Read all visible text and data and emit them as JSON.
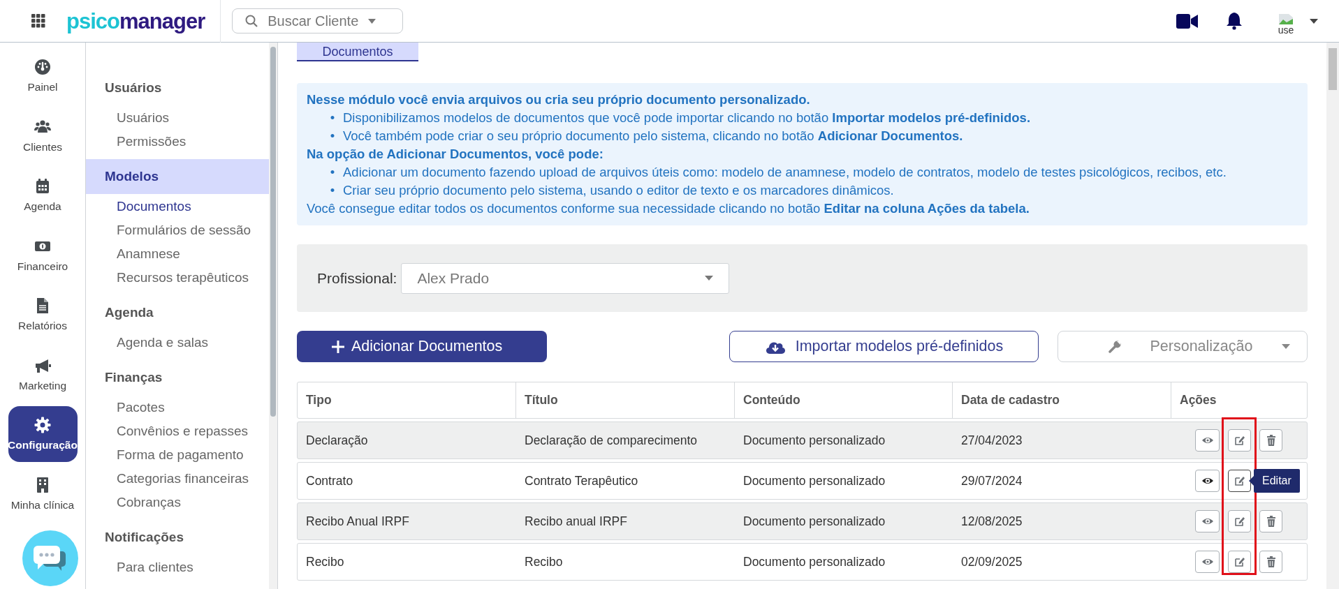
{
  "header": {
    "logo": {
      "part1": "psico",
      "part2": "manager"
    },
    "search": {
      "placeholder": "Buscar Cliente"
    },
    "avatar_alt": "use"
  },
  "nav": [
    {
      "label": "Painel",
      "selected": false
    },
    {
      "label": "Clientes",
      "selected": false
    },
    {
      "label": "Agenda",
      "selected": false
    },
    {
      "label": "Financeiro",
      "selected": false
    },
    {
      "label": "Relatórios",
      "selected": false
    },
    {
      "label": "Marketing",
      "selected": false
    },
    {
      "label": "Configuração",
      "selected": true
    },
    {
      "label": "Minha clínica",
      "selected": false
    }
  ],
  "settings_menu": [
    {
      "label": "Usuários",
      "selected": false,
      "items": [
        {
          "label": "Usuários",
          "selected": false
        },
        {
          "label": "Permissões",
          "selected": false
        }
      ]
    },
    {
      "label": "Modelos",
      "selected": true,
      "items": [
        {
          "label": "Documentos",
          "selected": true
        },
        {
          "label": "Formulários de sessão",
          "selected": false
        },
        {
          "label": "Anamnese",
          "selected": false
        },
        {
          "label": "Recursos terapêuticos",
          "selected": false
        }
      ]
    },
    {
      "label": "Agenda",
      "selected": false,
      "items": [
        {
          "label": "Agenda e salas",
          "selected": false
        }
      ]
    },
    {
      "label": "Finanças",
      "selected": false,
      "items": [
        {
          "label": "Pacotes",
          "selected": false
        },
        {
          "label": "Convênios e repasses",
          "selected": false
        },
        {
          "label": "Forma de pagamento",
          "selected": false
        },
        {
          "label": "Categorias financeiras",
          "selected": false
        },
        {
          "label": "Cobranças",
          "selected": false
        }
      ]
    },
    {
      "label": "Notificações",
      "selected": false,
      "items": [
        {
          "label": "Para clientes",
          "selected": false
        }
      ]
    }
  ],
  "tab": {
    "label": "Documentos"
  },
  "info": [
    {
      "kind": "heading",
      "text": "Nesse módulo você envia arquivos ou cria seu próprio documento personalizado."
    },
    {
      "kind": "bullet",
      "marker": "•",
      "text": "Disponibilizamos modelos de documentos que você pode importar clicando no botão **Importar modelos pré-definidos.**"
    },
    {
      "kind": "bullet",
      "marker": "•",
      "text": "Você também pode criar o seu próprio documento pelo sistema, clicando no botão **Adicionar Documentos.**"
    },
    {
      "kind": "heading",
      "text": "Na opção de Adicionar Documentos, você pode:"
    },
    {
      "kind": "bullet",
      "marker": "•",
      "text": "Adicionar um documento fazendo upload de arquivos úteis como: modelo de anamnese, modelo de contratos, modelo de testes psicológicos, recibos, etc."
    },
    {
      "kind": "bullet",
      "marker": "•",
      "text": "Criar seu próprio documento pelo sistema, usando o editor de texto e os marcadores dinâmicos."
    },
    {
      "kind": "text",
      "text": "Você consegue editar todos os documentos conforme sua necessidade clicando no botão **Editar na coluna Ações da tabela.**"
    }
  ],
  "filter": {
    "label": "Profissional:",
    "value": "Alex Prado"
  },
  "buttons": {
    "add": "Adicionar Documentos",
    "import": "Importar modelos pré-definidos",
    "customize": "Personalização"
  },
  "table": {
    "columns": [
      "Tipo",
      "Título",
      "Conteúdo",
      "Data de cadastro",
      "Ações"
    ],
    "rows": [
      {
        "type": "Declaração",
        "title": "Declaração de comparecimento",
        "content": "Documento personalizado",
        "date": "27/04/2023",
        "hovered": false
      },
      {
        "type": "Contrato",
        "title": "Contrato Terapêutico",
        "content": "Documento personalizado",
        "date": "29/07/2024",
        "hovered": true,
        "tooltip": "Editar"
      },
      {
        "type": "Recibo Anual IRPF",
        "title": "Recibo anual IRPF",
        "content": "Documento personalizado",
        "date": "12/08/2025",
        "hovered": false
      },
      {
        "type": "Recibo",
        "title": "Recibo",
        "content": "Documento personalizado",
        "date": "02/09/2025",
        "hovered": false
      }
    ]
  }
}
